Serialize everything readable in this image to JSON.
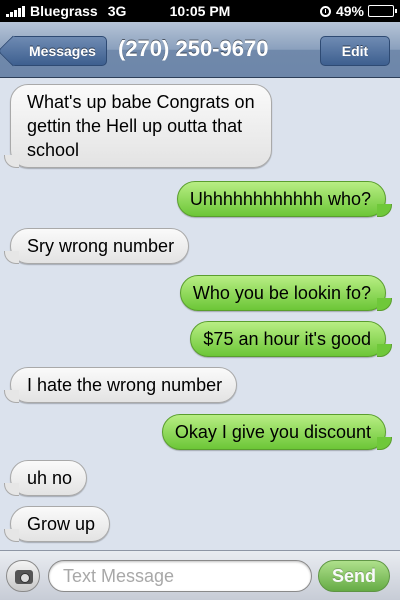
{
  "status_bar": {
    "carrier": "Bluegrass",
    "network": "3G",
    "time": "10:05 PM",
    "battery": "49%",
    "battery_level": 0.49,
    "icons": [
      "signal-bars-icon",
      "clock-icon",
      "battery-icon"
    ]
  },
  "nav": {
    "back_label": "Messages",
    "title": "(270) 250-9670",
    "edit_label": "Edit"
  },
  "messages": [
    {
      "direction": "incoming",
      "text": "What's up babe Congrats on gettin the Hell up outta that school"
    },
    {
      "direction": "outgoing",
      "text": "Uhhhhhhhhhhhh who?"
    },
    {
      "direction": "incoming",
      "text": "Sry wrong number"
    },
    {
      "direction": "outgoing",
      "text": "Who you be lookin fo?"
    },
    {
      "direction": "outgoing",
      "text": "$75 an hour it's good"
    },
    {
      "direction": "incoming",
      "text": "I hate the wrong number"
    },
    {
      "direction": "outgoing",
      "text": "Okay I give you discount"
    },
    {
      "direction": "incoming",
      "text": "uh no"
    },
    {
      "direction": "incoming",
      "text": "Grow up"
    }
  ],
  "compose": {
    "placeholder": "Text Message",
    "send_label": "Send",
    "camera_icon": "camera-icon"
  },
  "colors": {
    "outgoing_bubble": "#7dd049",
    "incoming_bubble": "#ececec",
    "nav_bar": "#7f96b5",
    "background": "#dbe2ed"
  }
}
